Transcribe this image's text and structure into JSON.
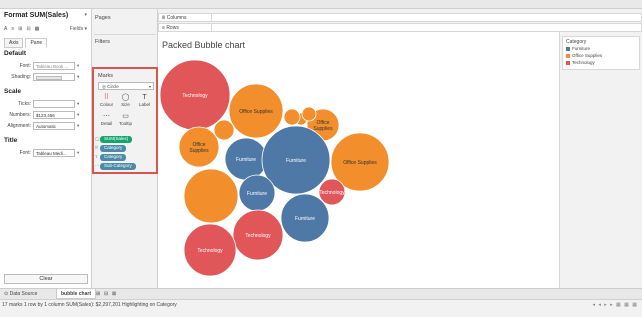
{
  "format_pane": {
    "title": "Format SUM(Sales)",
    "title_arrow": "▾",
    "toolbar_icons": [
      "A",
      "≡",
      "⊞",
      "⊟",
      "▦"
    ],
    "fields_label": "Fields ▾",
    "tabs": [
      "Axis",
      "Pane"
    ],
    "default_section": "Default",
    "font_label": "Font:",
    "font_value": "Tableau Book ...",
    "shading_label": "Shading:",
    "scale_section": "Scale",
    "ticks_label": "Ticks:",
    "numbers_label": "Numbers:",
    "numbers_value": "$123,456",
    "alignment_label": "Alignment:",
    "alignment_value": "Automatic",
    "title_section": "Title",
    "title_font_label": "Font:",
    "title_font_value": "Tableau Medi...",
    "clear_button": "Clear"
  },
  "shelves": {
    "pages": "Pages",
    "filters": "Filters",
    "columns": "Columns",
    "rows": "Rows",
    "columns_icon": "iii",
    "rows_icon": "≡"
  },
  "marks": {
    "title": "Marks",
    "mark_type": "Circle",
    "mark_type_icon": "◎",
    "buttons": [
      {
        "label": "Colour",
        "icon": "⠿"
      },
      {
        "label": "Size",
        "icon": "◯"
      },
      {
        "label": "Label",
        "icon": "T"
      },
      {
        "label": "Detail",
        "icon": "⋯"
      },
      {
        "label": "Tooltip",
        "icon": "▭"
      }
    ],
    "pills": [
      {
        "label": "SUM(Sales)",
        "prefix": "◯"
      },
      {
        "label": "Category",
        "prefix": "⠿"
      },
      {
        "label": "Category",
        "prefix": "T"
      },
      {
        "label": "Sub-Category",
        "prefix": "⋯"
      }
    ]
  },
  "view": {
    "title": "Packed  Bubble chart"
  },
  "legend": {
    "title": "Category",
    "items": [
      {
        "label": "Furniture",
        "color": "#4e79a7"
      },
      {
        "label": "Office Supplies",
        "color": "#f28e2b"
      },
      {
        "label": "Technology",
        "color": "#e15759"
      }
    ]
  },
  "bubbles": [
    {
      "label": "Technology",
      "category": "Technology",
      "color": "#e15759"
    },
    {
      "label": "Office Supplies",
      "category": "Office Supplies",
      "color": "#f28e2b"
    },
    {
      "label": "Office\nSupplies",
      "category": "Office Supplies",
      "color": "#f28e2b"
    },
    {
      "label": "",
      "category": "Office Supplies",
      "color": "#f28e2b"
    },
    {
      "label": "",
      "category": "Office Supplies",
      "color": "#f28e2b"
    },
    {
      "label": "",
      "category": "Office Supplies",
      "color": "#f28e2b"
    },
    {
      "label": "Office\nSupplies",
      "category": "Office Supplies",
      "color": "#f28e2b"
    },
    {
      "label": "Furniture",
      "category": "Furniture",
      "color": "#4e79a7"
    },
    {
      "label": "Furniture",
      "category": "Furniture",
      "color": "#4e79a7"
    },
    {
      "label": "Office Supplies",
      "category": "Office Supplies",
      "color": "#f28e2b"
    },
    {
      "label": "",
      "category": "Office Supplies",
      "color": "#f28e2b"
    },
    {
      "label": "Furniture",
      "category": "Furniture",
      "color": "#4e79a7"
    },
    {
      "label": "Furniture",
      "category": "Furniture",
      "color": "#4e79a7"
    },
    {
      "label": "Technology",
      "category": "Technology",
      "color": "#e15759"
    },
    {
      "label": "Technology",
      "category": "Technology",
      "color": "#e15759"
    },
    {
      "label": "Technology",
      "category": "Technology",
      "color": "#e15759"
    }
  ],
  "tabs": {
    "data_source": "Data Source",
    "data_source_icon": "⊙",
    "sheet": "bubble chart",
    "new_icons": [
      "⊞",
      "⊟",
      "⊠"
    ]
  },
  "status": {
    "text": "17 marks    1 row by 1 column    SUM(Sales): $2,297,201    Highlighting on Category",
    "nav": "◂ ◂ ▸ ▸ ▦ ▦ ▦"
  }
}
